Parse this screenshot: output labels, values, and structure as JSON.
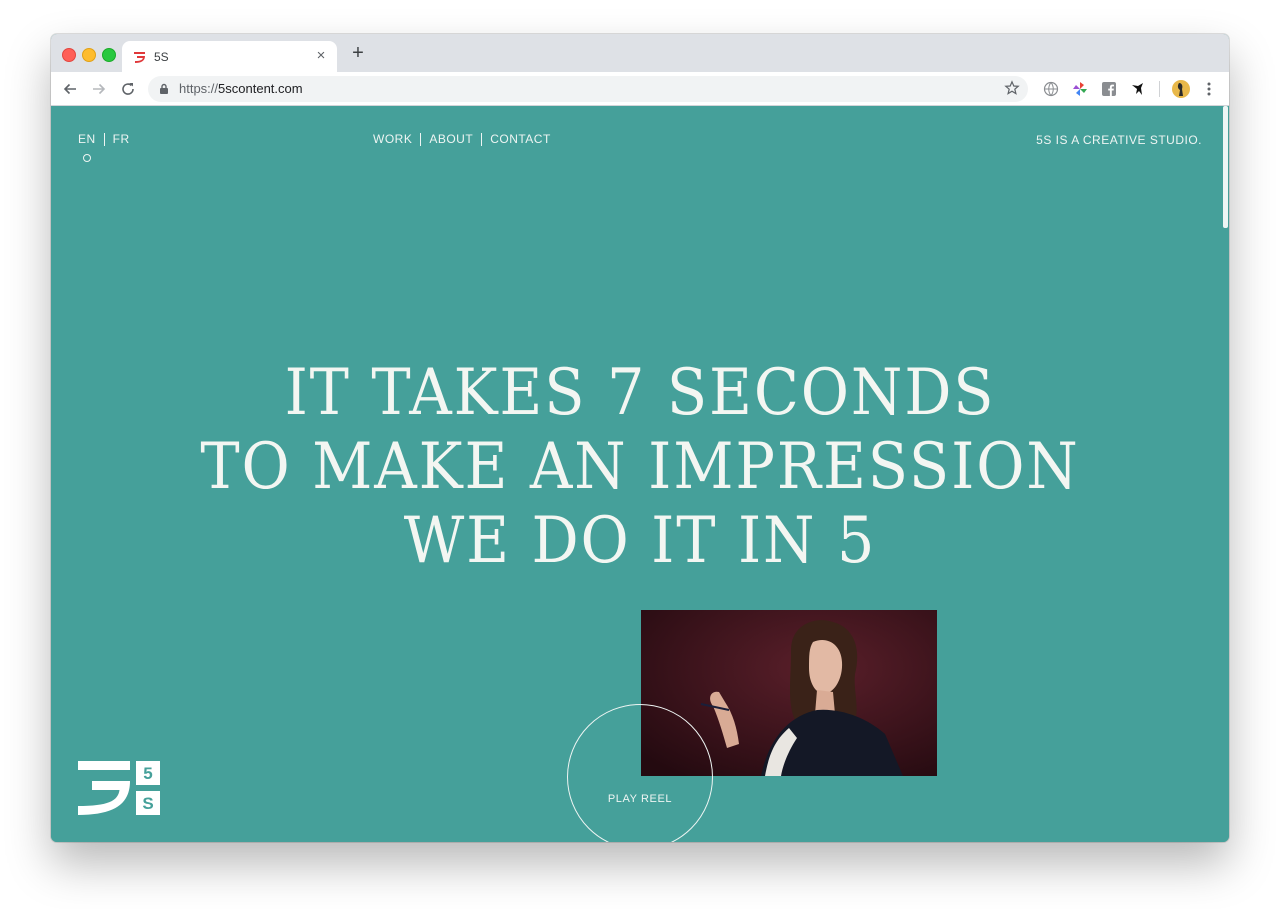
{
  "browser": {
    "tab": {
      "title": "5S",
      "favicon": "5s-logo-icon",
      "close_glyph": "×"
    },
    "new_tab_glyph": "+",
    "address": {
      "scheme": "https://",
      "host": "5scontent.com"
    },
    "extensions": [
      "globe-icon",
      "pinwheel-icon",
      "facebook-icon",
      "bird-icon",
      "profile-avatar"
    ],
    "favicon_color": "#e0383a"
  },
  "site": {
    "colors": {
      "background": "#45a09a",
      "text": "#eef5f3"
    },
    "language": {
      "items": [
        "EN",
        "FR"
      ]
    },
    "nav": {
      "items": [
        "WORK",
        "ABOUT",
        "CONTACT"
      ]
    },
    "tagline": "5S IS A CREATIVE STUDIO.",
    "hero": {
      "line1": "IT TAKES 7 SECONDS",
      "line2": "TO MAKE AN IMPRESSION",
      "line3": "WE DO IT IN 5"
    },
    "play_reel": "PLAY REEL",
    "logo": {
      "glyph_big": "ラ",
      "glyph_top": "5",
      "glyph_bottom": "S"
    }
  }
}
